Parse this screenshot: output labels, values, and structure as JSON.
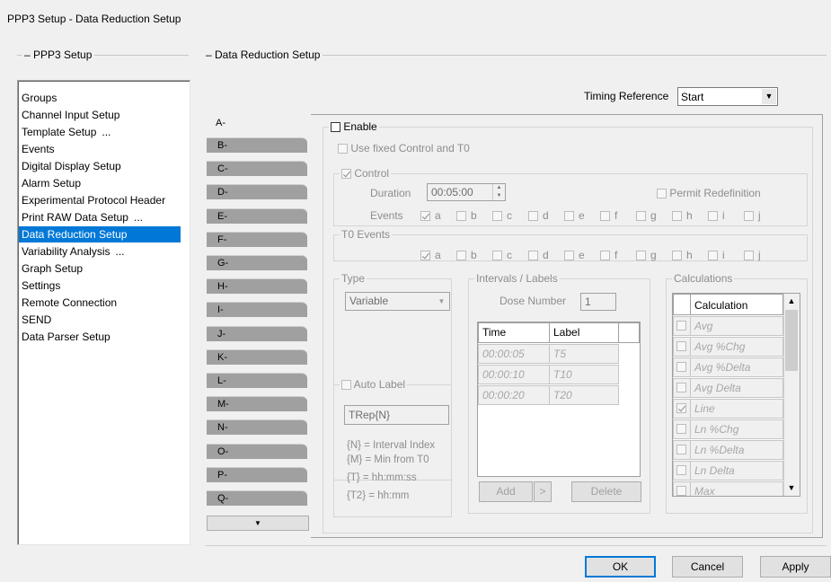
{
  "window": {
    "title": "PPP3 Setup - Data Reduction Setup"
  },
  "left_group": {
    "label": "PPP3 Setup"
  },
  "right_group": {
    "label": "Data Reduction Setup"
  },
  "tree": {
    "items": [
      {
        "label": "Groups"
      },
      {
        "label": "Channel Input Setup"
      },
      {
        "label": "Template Setup",
        "suffix": "..."
      },
      {
        "label": "Events"
      },
      {
        "label": "Digital Display Setup"
      },
      {
        "label": "Alarm Setup"
      },
      {
        "label": "Experimental Protocol Header"
      },
      {
        "label": "Print RAW Data Setup",
        "suffix": "..."
      },
      {
        "label": "Data Reduction Setup",
        "selected": true
      },
      {
        "label": "Variability Analysis",
        "suffix": "..."
      },
      {
        "label": "Graph Setup"
      },
      {
        "label": "Settings"
      },
      {
        "label": "Remote Connection"
      },
      {
        "label": "SEND"
      },
      {
        "label": "Data Parser Setup"
      }
    ]
  },
  "timing": {
    "label": "Timing Reference",
    "value": "Start"
  },
  "tabs": [
    "A-",
    "B-",
    "C-",
    "D-",
    "E-",
    "F-",
    "G-",
    "H-",
    "I-",
    "J-",
    "K-",
    "L-",
    "M-",
    "N-",
    "O-",
    "P-",
    "Q-"
  ],
  "tab_scroll_icon": "down-arrow",
  "enable": {
    "label": "Enable",
    "checked": false
  },
  "use_fixed": {
    "label": "Use fixed Control and T0"
  },
  "control": {
    "label": "Control",
    "checked": true,
    "duration_label": "Duration",
    "duration_value": "00:05:00",
    "permit_label": "Permit Redefinition",
    "events_label": "Events",
    "events": [
      "a",
      "b",
      "c",
      "d",
      "e",
      "f",
      "g",
      "h",
      "i",
      "j"
    ]
  },
  "t0": {
    "label": "T0 Events",
    "events": [
      "a",
      "b",
      "c",
      "d",
      "e",
      "f",
      "g",
      "h",
      "i",
      "j"
    ]
  },
  "type": {
    "label": "Type",
    "value": "Variable"
  },
  "intervals": {
    "label": "Intervals / Labels",
    "dose_label": "Dose Number",
    "dose_value": "1",
    "col_time": "Time",
    "col_label": "Label",
    "rows": [
      {
        "time": "00:00:05",
        "label": "T5"
      },
      {
        "time": "00:00:10",
        "label": "T10"
      },
      {
        "time": "00:00:20",
        "label": "T20"
      }
    ],
    "add": "Add",
    "arrow": ">",
    "delete": "Delete"
  },
  "auto_label": {
    "label": "Auto Label",
    "value": "TRep{N}",
    "help1": "{N} = Interval Index",
    "help2": "{M} = Min from T0",
    "help3": "{T} = hh:mm:ss",
    "help4": "{T2} = hh:mm"
  },
  "calculations": {
    "label": "Calculations",
    "header": "Calculation",
    "rows": [
      {
        "label": "Avg",
        "checked": false
      },
      {
        "label": "Avg %Chg",
        "checked": false
      },
      {
        "label": "Avg %Delta",
        "checked": false
      },
      {
        "label": "Avg Delta",
        "checked": false
      },
      {
        "label": "Line",
        "checked": true
      },
      {
        "label": "Ln %Chg",
        "checked": false
      },
      {
        "label": "Ln %Delta",
        "checked": false
      },
      {
        "label": "Ln Delta",
        "checked": false
      },
      {
        "label": "Max",
        "checked": false
      }
    ]
  },
  "buttons": {
    "ok": "OK",
    "cancel": "Cancel",
    "apply": "Apply"
  }
}
